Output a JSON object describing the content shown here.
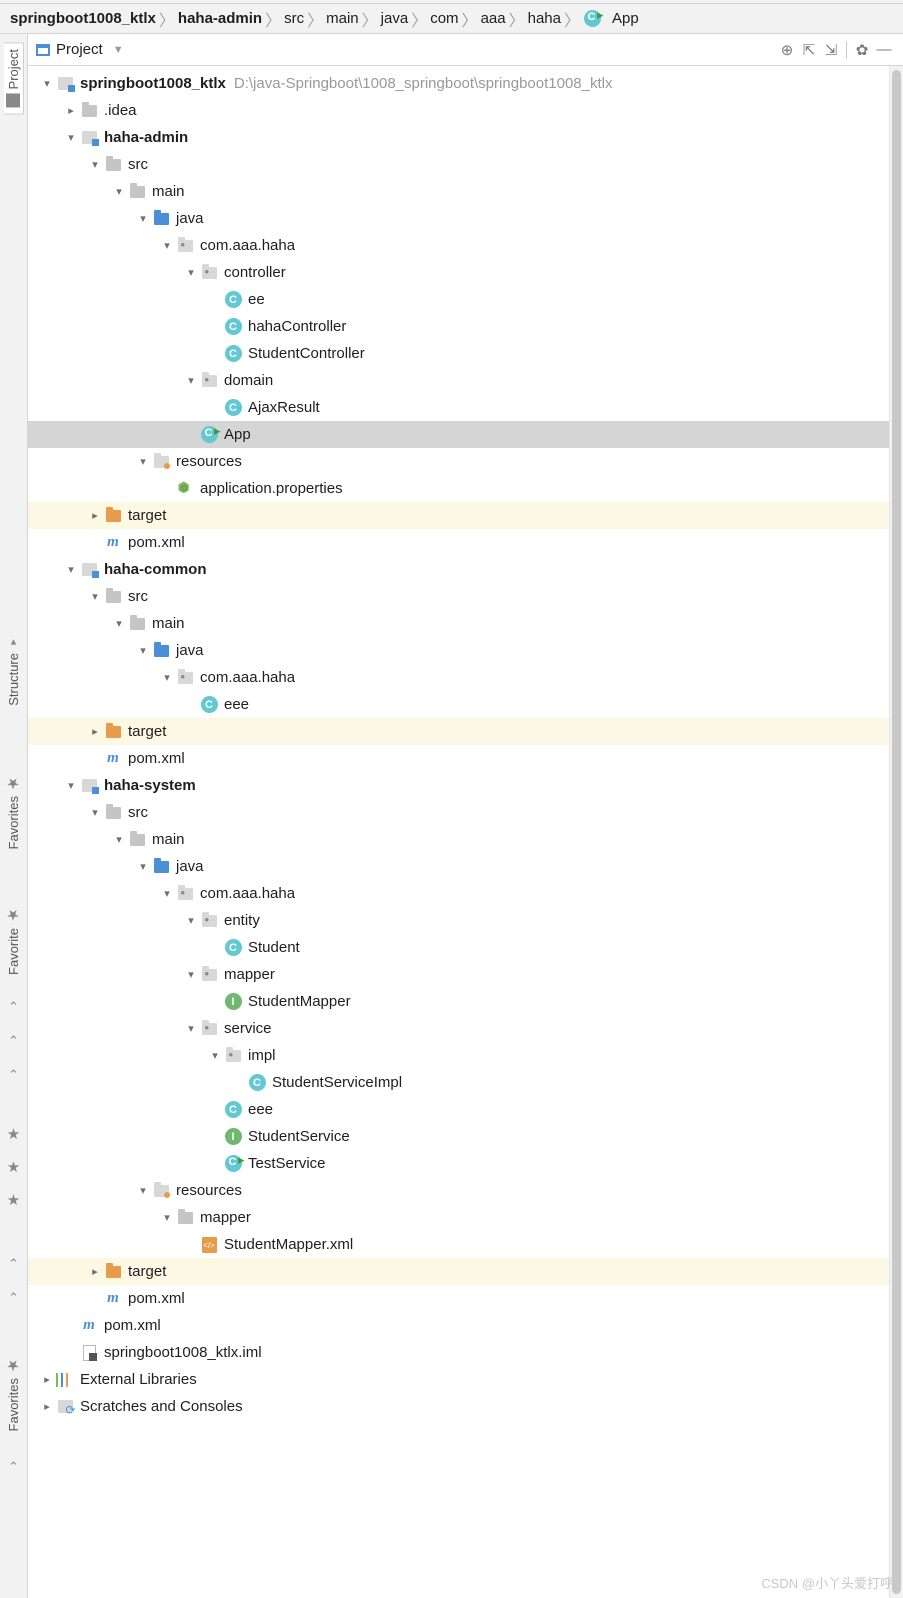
{
  "breadcrumb": [
    "springboot1008_ktlx",
    "haha-admin",
    "src",
    "main",
    "java",
    "com",
    "aaa",
    "haha",
    "App"
  ],
  "panel": {
    "title": "Project"
  },
  "sideTabs": {
    "project": "Project",
    "structure": "Structure",
    "favorites": "Favorites",
    "favorite": "Favorite",
    "favorites2": "Favorites"
  },
  "rootPath": "D:\\java-Springboot\\1008_springboot\\springboot1008_ktlx",
  "tree": [
    {
      "d": 0,
      "arrow": "down",
      "icon": "module",
      "label": "springboot1008_ktlx",
      "bold": true,
      "path": true
    },
    {
      "d": 1,
      "arrow": "right",
      "icon": "folder",
      "label": ".idea"
    },
    {
      "d": 1,
      "arrow": "down",
      "icon": "module",
      "label": "haha-admin",
      "bold": true
    },
    {
      "d": 2,
      "arrow": "down",
      "icon": "folder",
      "label": "src"
    },
    {
      "d": 3,
      "arrow": "down",
      "icon": "folder",
      "label": "main"
    },
    {
      "d": 4,
      "arrow": "down",
      "icon": "folder-blue",
      "label": "java"
    },
    {
      "d": 5,
      "arrow": "down",
      "icon": "package",
      "label": "com.aaa.haha"
    },
    {
      "d": 6,
      "arrow": "down",
      "icon": "package",
      "label": "controller"
    },
    {
      "d": 7,
      "arrow": "",
      "icon": "class",
      "label": "ee"
    },
    {
      "d": 7,
      "arrow": "",
      "icon": "class",
      "label": "hahaController"
    },
    {
      "d": 7,
      "arrow": "",
      "icon": "class",
      "label": "StudentController"
    },
    {
      "d": 6,
      "arrow": "down",
      "icon": "package",
      "label": "domain"
    },
    {
      "d": 7,
      "arrow": "",
      "icon": "class",
      "label": "AjaxResult"
    },
    {
      "d": 6,
      "arrow": "",
      "icon": "runclass",
      "label": "App",
      "selected": true
    },
    {
      "d": 4,
      "arrow": "down",
      "icon": "resources",
      "label": "resources"
    },
    {
      "d": 5,
      "arrow": "",
      "icon": "props",
      "label": "application.properties"
    },
    {
      "d": 2,
      "arrow": "right",
      "icon": "folder-orange",
      "label": "target",
      "dirty": true
    },
    {
      "d": 2,
      "arrow": "",
      "icon": "maven",
      "label": "pom.xml"
    },
    {
      "d": 1,
      "arrow": "down",
      "icon": "module",
      "label": "haha-common",
      "bold": true
    },
    {
      "d": 2,
      "arrow": "down",
      "icon": "folder",
      "label": "src"
    },
    {
      "d": 3,
      "arrow": "down",
      "icon": "folder",
      "label": "main"
    },
    {
      "d": 4,
      "arrow": "down",
      "icon": "folder-blue",
      "label": "java"
    },
    {
      "d": 5,
      "arrow": "down",
      "icon": "package",
      "label": "com.aaa.haha"
    },
    {
      "d": 6,
      "arrow": "",
      "icon": "class",
      "label": "eee"
    },
    {
      "d": 2,
      "arrow": "right",
      "icon": "folder-orange",
      "label": "target",
      "dirty": true
    },
    {
      "d": 2,
      "arrow": "",
      "icon": "maven",
      "label": "pom.xml"
    },
    {
      "d": 1,
      "arrow": "down",
      "icon": "module",
      "label": "haha-system",
      "bold": true
    },
    {
      "d": 2,
      "arrow": "down",
      "icon": "folder",
      "label": "src"
    },
    {
      "d": 3,
      "arrow": "down",
      "icon": "folder",
      "label": "main"
    },
    {
      "d": 4,
      "arrow": "down",
      "icon": "folder-blue",
      "label": "java"
    },
    {
      "d": 5,
      "arrow": "down",
      "icon": "package",
      "label": "com.aaa.haha"
    },
    {
      "d": 6,
      "arrow": "down",
      "icon": "package",
      "label": "entity"
    },
    {
      "d": 7,
      "arrow": "",
      "icon": "class",
      "label": "Student"
    },
    {
      "d": 6,
      "arrow": "down",
      "icon": "package",
      "label": "mapper"
    },
    {
      "d": 7,
      "arrow": "",
      "icon": "interface",
      "label": "StudentMapper"
    },
    {
      "d": 6,
      "arrow": "down",
      "icon": "package",
      "label": "service"
    },
    {
      "d": 7,
      "arrow": "down",
      "icon": "package",
      "label": "impl"
    },
    {
      "d": 8,
      "arrow": "",
      "icon": "class",
      "label": "StudentServiceImpl"
    },
    {
      "d": 7,
      "arrow": "",
      "icon": "class",
      "label": "eee"
    },
    {
      "d": 7,
      "arrow": "",
      "icon": "interface",
      "label": "StudentService"
    },
    {
      "d": 7,
      "arrow": "",
      "icon": "runclass",
      "label": "TestService"
    },
    {
      "d": 4,
      "arrow": "down",
      "icon": "resources",
      "label": "resources"
    },
    {
      "d": 5,
      "arrow": "down",
      "icon": "folder",
      "label": "mapper"
    },
    {
      "d": 6,
      "arrow": "",
      "icon": "xml",
      "label": "StudentMapper.xml"
    },
    {
      "d": 2,
      "arrow": "right",
      "icon": "folder-orange",
      "label": "target",
      "dirty": true
    },
    {
      "d": 2,
      "arrow": "",
      "icon": "maven",
      "label": "pom.xml"
    },
    {
      "d": 1,
      "arrow": "",
      "icon": "maven",
      "label": "pom.xml"
    },
    {
      "d": 1,
      "arrow": "",
      "icon": "iml",
      "label": "springboot1008_ktlx.iml"
    },
    {
      "d": 0,
      "arrow": "right",
      "icon": "libs",
      "label": "External Libraries"
    },
    {
      "d": 0,
      "arrow": "right",
      "icon": "scratch",
      "label": "Scratches and Consoles"
    }
  ],
  "watermark": "CSDN @小丫头爱打呼"
}
